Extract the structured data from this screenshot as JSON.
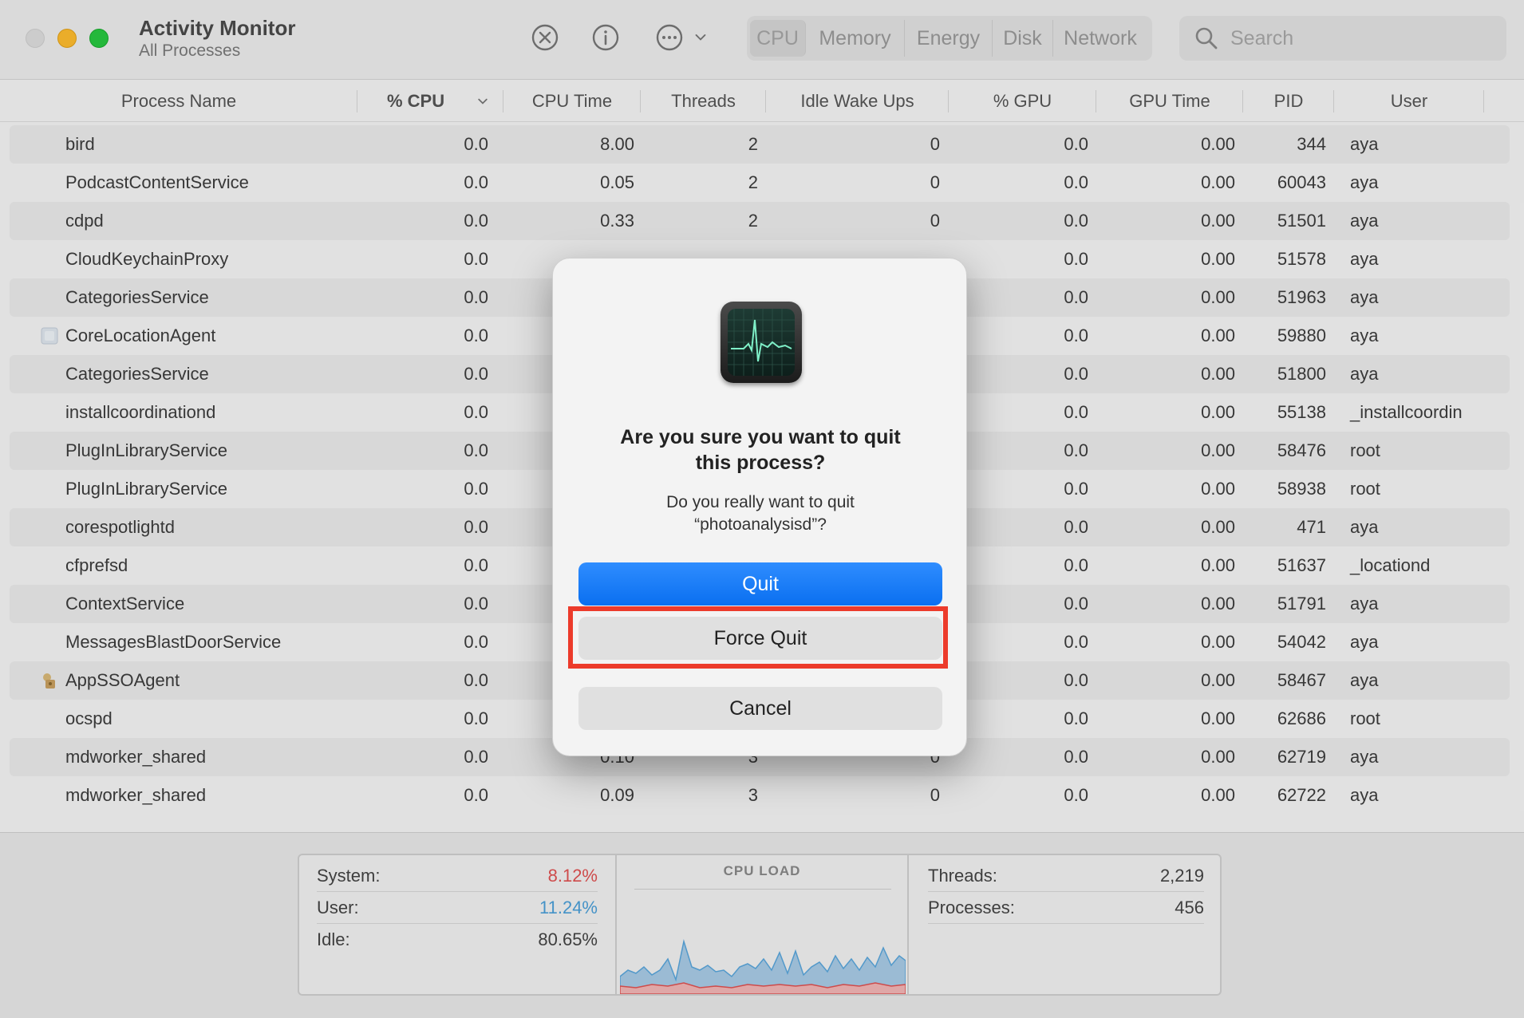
{
  "window": {
    "title": "Activity Monitor",
    "subtitle": "All Processes"
  },
  "toolbar": {
    "icons": [
      "stop-process-icon",
      "info-icon",
      "more-options-icon",
      "chevron-down-icon"
    ],
    "tabs": [
      "CPU",
      "Memory",
      "Energy",
      "Disk",
      "Network"
    ],
    "active_tab": "CPU",
    "search_placeholder": "Search"
  },
  "table": {
    "columns": [
      "Process Name",
      "% CPU",
      "CPU Time",
      "Threads",
      "Idle Wake Ups",
      "% GPU",
      "GPU Time",
      "PID",
      "User"
    ],
    "rows": [
      {
        "name": "bird",
        "cpu": "0.0",
        "cpu_time": "8.00",
        "threads": "2",
        "idle": "0",
        "gpu": "0.0",
        "gpu_time": "0.00",
        "pid": "344",
        "user": "aya"
      },
      {
        "name": "PodcastContentService",
        "cpu": "0.0",
        "cpu_time": "0.05",
        "threads": "2",
        "idle": "0",
        "gpu": "0.0",
        "gpu_time": "0.00",
        "pid": "60043",
        "user": "aya"
      },
      {
        "name": "cdpd",
        "cpu": "0.0",
        "cpu_time": "0.33",
        "threads": "2",
        "idle": "0",
        "gpu": "0.0",
        "gpu_time": "0.00",
        "pid": "51501",
        "user": "aya"
      },
      {
        "name": "CloudKeychainProxy",
        "cpu": "0.0",
        "cpu_time": "",
        "threads": "",
        "idle": "",
        "gpu": "0.0",
        "gpu_time": "0.00",
        "pid": "51578",
        "user": "aya"
      },
      {
        "name": "CategoriesService",
        "cpu": "0.0",
        "cpu_time": "",
        "threads": "",
        "idle": "",
        "gpu": "0.0",
        "gpu_time": "0.00",
        "pid": "51963",
        "user": "aya"
      },
      {
        "name": "CoreLocationAgent",
        "cpu": "0.0",
        "cpu_time": "",
        "threads": "",
        "idle": "",
        "gpu": "0.0",
        "gpu_time": "0.00",
        "pid": "59880",
        "user": "aya",
        "icon": "location-agent-icon"
      },
      {
        "name": "CategoriesService",
        "cpu": "0.0",
        "cpu_time": "",
        "threads": "",
        "idle": "",
        "gpu": "0.0",
        "gpu_time": "0.00",
        "pid": "51800",
        "user": "aya"
      },
      {
        "name": "installcoordinationd",
        "cpu": "0.0",
        "cpu_time": "",
        "threads": "",
        "idle": "",
        "gpu": "0.0",
        "gpu_time": "0.00",
        "pid": "55138",
        "user": "_installcoordin"
      },
      {
        "name": "PlugInLibraryService",
        "cpu": "0.0",
        "cpu_time": "",
        "threads": "",
        "idle": "",
        "gpu": "0.0",
        "gpu_time": "0.00",
        "pid": "58476",
        "user": "root"
      },
      {
        "name": "PlugInLibraryService",
        "cpu": "0.0",
        "cpu_time": "",
        "threads": "",
        "idle": "",
        "gpu": "0.0",
        "gpu_time": "0.00",
        "pid": "58938",
        "user": "root"
      },
      {
        "name": "corespotlightd",
        "cpu": "0.0",
        "cpu_time": "",
        "threads": "",
        "idle": "",
        "gpu": "0.0",
        "gpu_time": "0.00",
        "pid": "471",
        "user": "aya"
      },
      {
        "name": "cfprefsd",
        "cpu": "0.0",
        "cpu_time": "",
        "threads": "",
        "idle": "",
        "gpu": "0.0",
        "gpu_time": "0.00",
        "pid": "51637",
        "user": "_locationd"
      },
      {
        "name": "ContextService",
        "cpu": "0.0",
        "cpu_time": "",
        "threads": "",
        "idle": "",
        "gpu": "0.0",
        "gpu_time": "0.00",
        "pid": "51791",
        "user": "aya"
      },
      {
        "name": "MessagesBlastDoorService",
        "cpu": "0.0",
        "cpu_time": "",
        "threads": "",
        "idle": "",
        "gpu": "0.0",
        "gpu_time": "0.00",
        "pid": "54042",
        "user": "aya"
      },
      {
        "name": "AppSSOAgent",
        "cpu": "0.0",
        "cpu_time": "",
        "threads": "",
        "idle": "",
        "gpu": "0.0",
        "gpu_time": "0.00",
        "pid": "58467",
        "user": "aya",
        "icon": "app-sso-icon"
      },
      {
        "name": "ocspd",
        "cpu": "0.0",
        "cpu_time": "",
        "threads": "",
        "idle": "",
        "gpu": "0.0",
        "gpu_time": "0.00",
        "pid": "62686",
        "user": "root"
      },
      {
        "name": "mdworker_shared",
        "cpu": "0.0",
        "cpu_time": "0.10",
        "threads": "3",
        "idle": "0",
        "gpu": "0.0",
        "gpu_time": "0.00",
        "pid": "62719",
        "user": "aya"
      },
      {
        "name": "mdworker_shared",
        "cpu": "0.0",
        "cpu_time": "0.09",
        "threads": "3",
        "idle": "0",
        "gpu": "0.0",
        "gpu_time": "0.00",
        "pid": "62722",
        "user": "aya"
      }
    ]
  },
  "footer": {
    "system_label": "System:",
    "system_value": "8.12%",
    "user_label": "User:",
    "user_value": "11.24%",
    "idle_label": "Idle:",
    "idle_value": "80.65%",
    "graph_title": "CPU LOAD",
    "threads_label": "Threads:",
    "threads_value": "2,219",
    "processes_label": "Processes:",
    "processes_value": "456",
    "colors": {
      "system": "#e05252",
      "user": "#4a9fd8"
    }
  },
  "dialog": {
    "title": "Are you sure you want to quit this process?",
    "message": "Do you really want to quit “photoanalysisd”?",
    "quit_label": "Quit",
    "force_quit_label": "Force Quit",
    "cancel_label": "Cancel",
    "icon": "activity-monitor-icon",
    "highlight_color": "#ec3b2b"
  }
}
